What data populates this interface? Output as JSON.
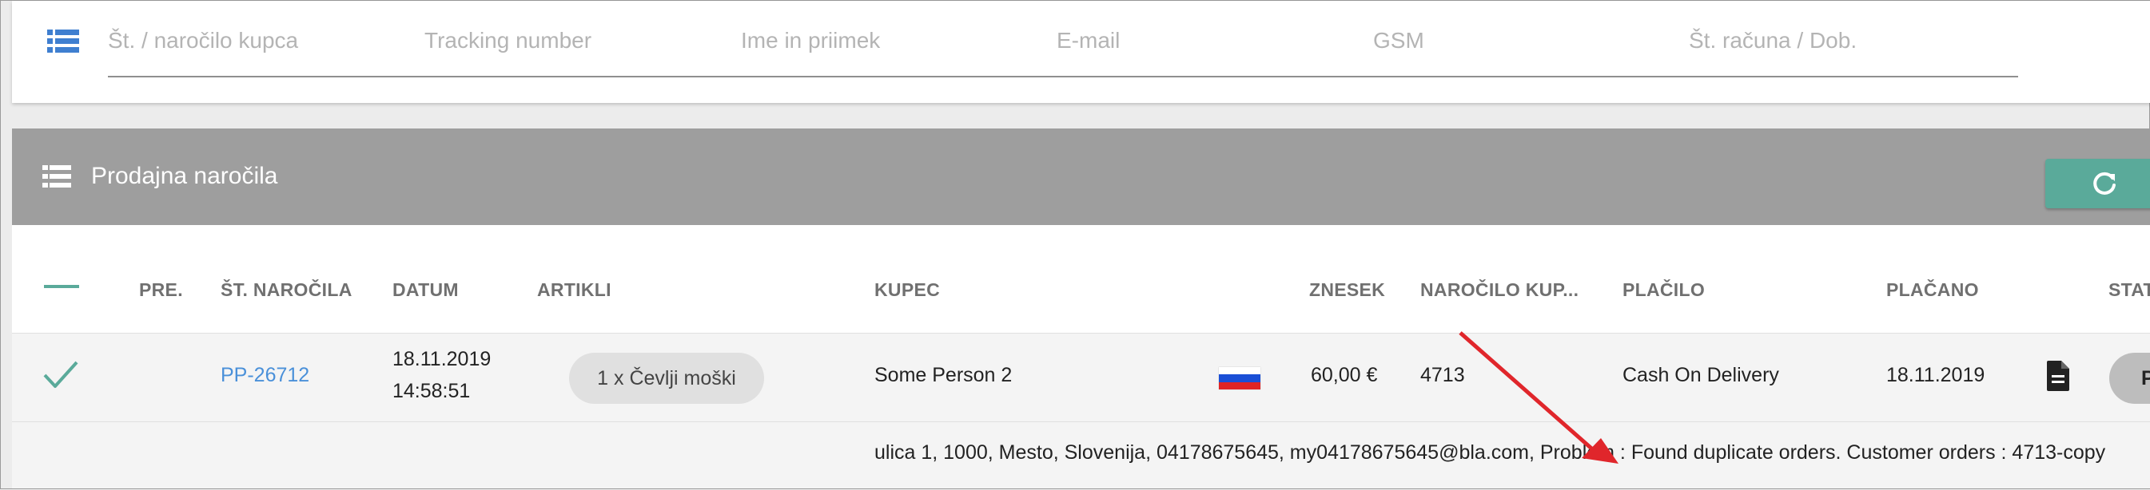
{
  "search": {
    "fields": [
      {
        "placeholder": "Št. / naročilo kupca"
      },
      {
        "placeholder": "Tracking number"
      },
      {
        "placeholder": "Ime in priimek"
      },
      {
        "placeholder": "E-mail"
      },
      {
        "placeholder": "GSM"
      },
      {
        "placeholder": "Št. računa / Dob."
      }
    ]
  },
  "header": {
    "title": "Prodajna naročila",
    "icon": "list-icon",
    "refresh_icon": "refresh-icon"
  },
  "table": {
    "columns": {
      "pre": "PRE.",
      "order_no": "ŠT. NAROČILA",
      "date": "DATUM",
      "articles": "ARTIKLI",
      "customer": "KUPEC",
      "amount": "ZNESEK",
      "customer_order": "NAROČILO KUP...",
      "payment": "PLAČILO",
      "paid": "PLAČANO",
      "status": "STAT"
    },
    "row": {
      "order_no": "PP-26712",
      "date": "18.11.2019",
      "time": "14:58:51",
      "articles": "1 x Čevlji moški",
      "customer": "Some Person 2",
      "country_flag": "slovenia-flag",
      "amount": "60,00 €",
      "customer_order": "4713",
      "payment": "Cash On Delivery",
      "paid_date": "18.11.2019",
      "document_icon": "document-icon",
      "status": "Pr"
    },
    "detail": "ulica 1, 1000, Mesto, Slovenija, 04178675645, my04178675645@bla.com, Problem : Found duplicate orders. Customer orders : 4713-copy"
  },
  "colors": {
    "accent": "#5aaa9a",
    "header_bg": "#9e9e9e",
    "link": "#4a90d9",
    "annotation_arrow": "#e0262b"
  }
}
